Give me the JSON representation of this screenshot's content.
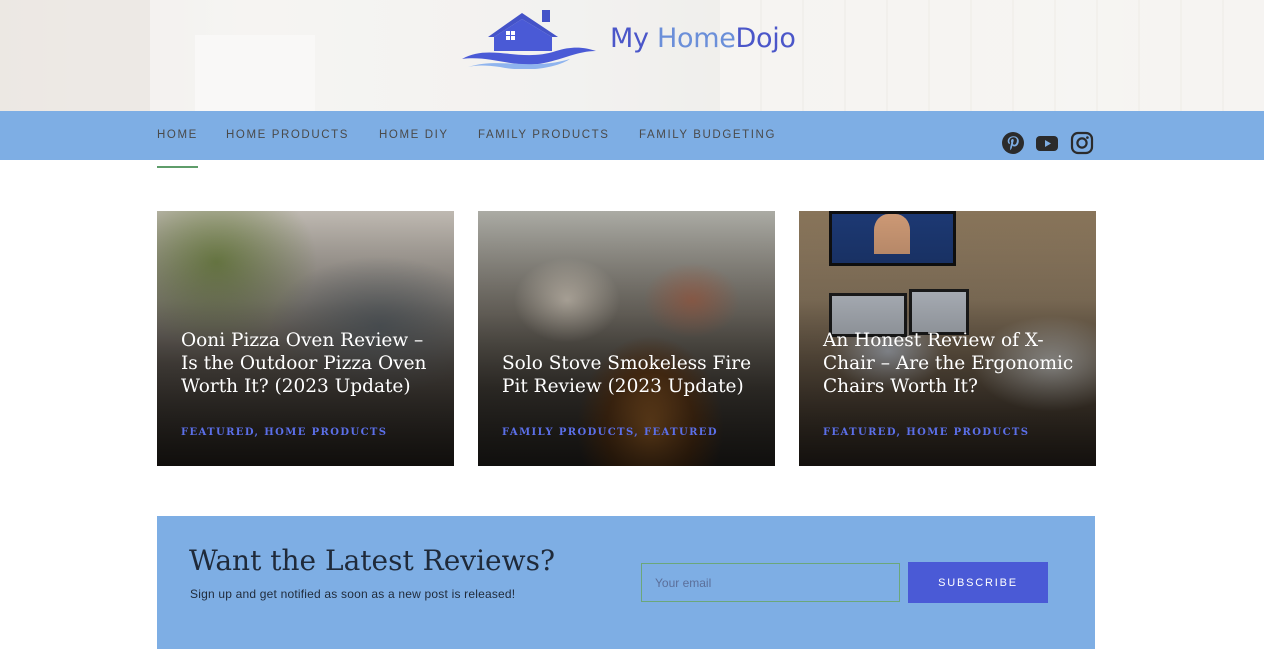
{
  "site": {
    "logo_text_my": "My ",
    "logo_text_home": "Home",
    "logo_text_dojo": "Dojo"
  },
  "nav": {
    "items": [
      {
        "label": "HOME",
        "active": true
      },
      {
        "label": "HOME PRODUCTS",
        "active": false
      },
      {
        "label": "HOME DIY",
        "active": false
      },
      {
        "label": "FAMILY PRODUCTS",
        "active": false
      },
      {
        "label": "FAMILY BUDGETING",
        "active": false
      }
    ],
    "social": [
      "pinterest-icon",
      "youtube-icon",
      "instagram-icon"
    ]
  },
  "posts": [
    {
      "title": "Ooni Pizza Oven Review – Is the Outdoor Pizza Oven Worth It? (2023 Update)",
      "categories": "FEATURED, HOME PRODUCTS"
    },
    {
      "title": "Solo Stove Smokeless Fire Pit Review (2023 Update)",
      "categories": "FAMILY PRODUCTS, FEATURED"
    },
    {
      "title": "An Honest Review of X-Chair – Are the Ergonomic Chairs Worth It?",
      "categories": "FEATURED, HOME PRODUCTS"
    }
  ],
  "newsletter": {
    "title": "Want the Latest Reviews?",
    "subtitle": "Sign up and get notified as soon as a new post is released!",
    "email_placeholder": "Your email",
    "button_label": "SUBSCRIBE"
  },
  "colors": {
    "nav_bg": "#7eaee4",
    "accent_blue": "#4a5ad6",
    "category_blue": "#5b6fe8",
    "active_underline": "#5f9d6a"
  }
}
